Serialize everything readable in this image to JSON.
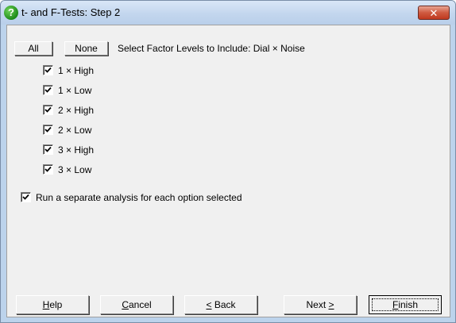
{
  "window": {
    "title": "t- and F-Tests: Step 2",
    "close_glyph": "✕",
    "icon": "help-question-icon",
    "accent_color": "#bcd3ec"
  },
  "selector": {
    "all_label": "All",
    "none_label": "None",
    "select_text": "Select Factor Levels to Include: Dial × Noise"
  },
  "levels": [
    {
      "label": "1 × High",
      "checked": true
    },
    {
      "label": "1 × Low",
      "checked": true
    },
    {
      "label": "2 × High",
      "checked": true
    },
    {
      "label": "2 × Low",
      "checked": true
    },
    {
      "label": "3 × High",
      "checked": true
    },
    {
      "label": "3 × Low",
      "checked": true
    }
  ],
  "options": {
    "separate_analysis_label": "Run a separate analysis for each option selected",
    "separate_analysis_checked": true
  },
  "buttons": {
    "help": {
      "mnemonic": "H",
      "rest": "elp"
    },
    "cancel": {
      "mnemonic": "C",
      "rest": "ancel"
    },
    "back": {
      "pre": "",
      "mnemonic": "<",
      "rest": " Back"
    },
    "next": {
      "pre": "Next ",
      "mnemonic": ">",
      "rest": ""
    },
    "finish": {
      "mnemonic": "F",
      "rest": "inish"
    }
  }
}
